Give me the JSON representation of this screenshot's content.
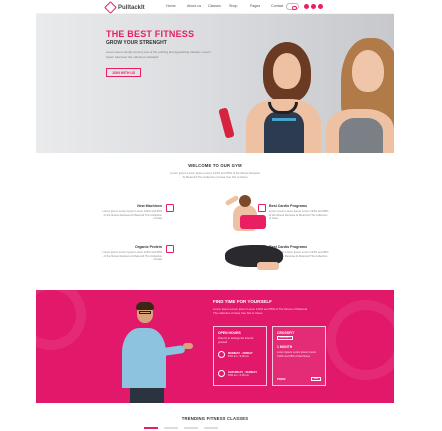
{
  "brand": {
    "name": "PulltackIt",
    "accent": "#e91e63"
  },
  "nav": {
    "items": [
      "Home",
      "About us",
      "Classes",
      "Shop",
      "Pages",
      "Contact"
    ]
  },
  "hero": {
    "title": "THE BEST FITNESS",
    "subtitle": "GROW YOUR STRENGHT",
    "text": "Lorem ipsum simply dummy text of the printing and typesetting industry. Lorem Ipsum has been the industry's standard",
    "button": "JOIN WITH US"
  },
  "welcome": {
    "title": "WELCOME TO OUR GYM",
    "text": "Lorem Ipsum Lorem Ipsum Lorem 123% and 95% of the fitness Reviews At Meteroid The Collection of Iowa Can Not to Clean"
  },
  "features": [
    {
      "title": "New Machines",
      "text": "Lorem Ipsum Lorem Ipsum Lorem 123% and 95% of the fitness Reviews At Meteroid The Collection of Iowa"
    },
    {
      "title": "Organic Protein",
      "text": "Lorem Ipsum Lorem Ipsum Lorem 123% and 95% of the fitness Reviews At Meteroid The Collection of Iowa"
    },
    {
      "title": "Best Cardio Programs",
      "text": "Lorem Ipsum Lorem Ipsum Lorem 123% and 95% of the fitness Reviews At Meteroid The Collection of Iowa"
    },
    {
      "title": "Best Cardio Programs",
      "text": "Lorem Ipsum Lorem Ipsum Lorem 123% and 95% of the fitness Reviews At Meteroid The Collection of Iowa"
    }
  ],
  "promo": {
    "title": "FIND TIME FOR YOURSELF",
    "text": "Lorem Ipsum Lorem Ipsum Lorem 123% and 95% of The fitness of Meteroid The collection of Iowa Can Not to Clean",
    "hours": {
      "title": "OPEN HOURS",
      "text": "Drop by or arrange the time for yourself",
      "rows": [
        {
          "day": "MONDAY - FRIDAY",
          "hours": "8:00 am - 9:00 pm"
        },
        {
          "day": "SATURDAY - SUNDAY",
          "hours": "8:00 am - 6:00 pm"
        }
      ]
    },
    "crossfit": {
      "title": "CROSSFIT",
      "tag": "CROSSFIT",
      "class_title": "1 MONTH",
      "class_text": "Lorem Ipsum Lorem Ipsum Lorem 123% and 95% of the fitness",
      "price_label": "PRICE",
      "price_button": "$99"
    }
  },
  "trending": {
    "title": "TRENDING FITNESS CLASSES"
  }
}
